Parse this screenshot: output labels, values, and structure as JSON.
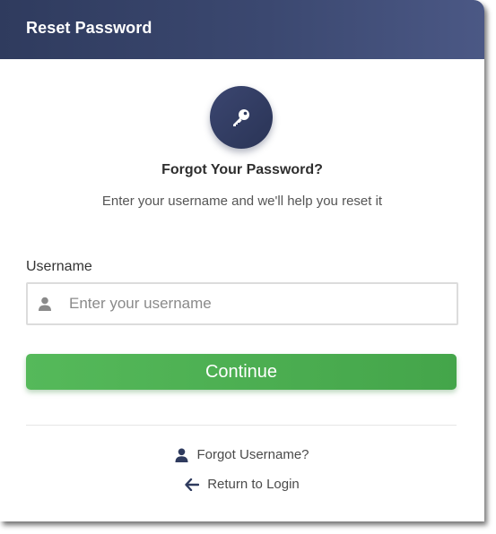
{
  "header": {
    "title": "Reset Password"
  },
  "colors": {
    "header": "#3b4870",
    "accent": "#2f3b5e",
    "continue": "#4caf50"
  },
  "icons": {
    "hero": "key-icon",
    "input": "user-icon",
    "forgot": "user-icon",
    "return": "arrow-left-icon"
  },
  "main": {
    "heading": "Forgot Your Password?",
    "subheading": "Enter your username and we'll help you reset it"
  },
  "form": {
    "username_label": "Username",
    "username_placeholder": "Enter your username",
    "username_value": "",
    "continue_label": "Continue"
  },
  "links": {
    "forgot_username": "Forgot Username?",
    "return_login": "Return to Login"
  }
}
